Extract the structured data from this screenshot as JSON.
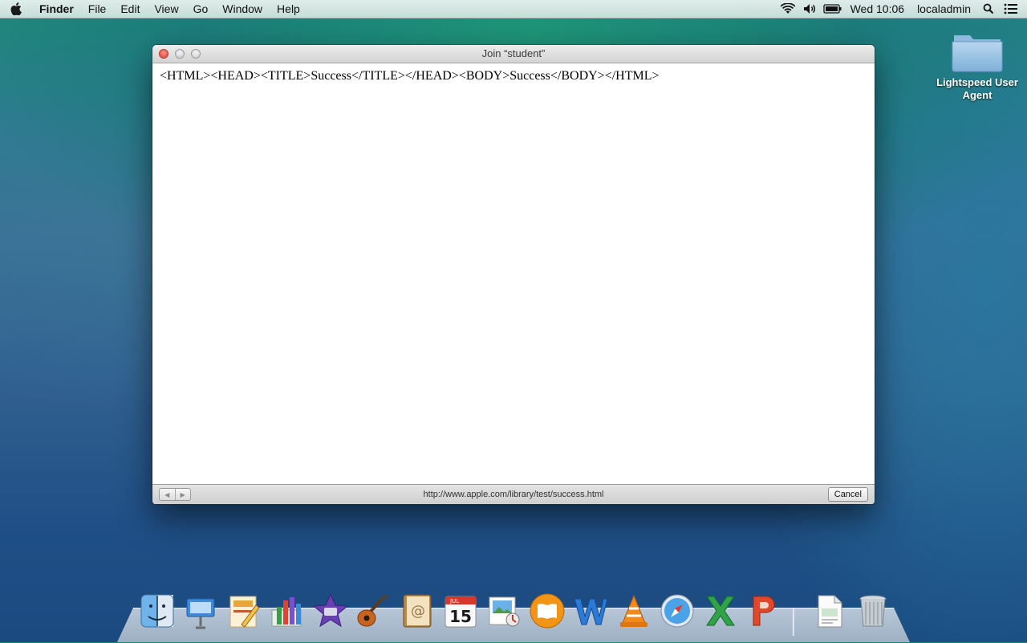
{
  "menubar": {
    "app_name": "Finder",
    "menus": [
      "File",
      "Edit",
      "View",
      "Go",
      "Window",
      "Help"
    ],
    "clock": "Wed 10:06",
    "user": "localadmin"
  },
  "desktop": {
    "folder_label": "Lightspeed User Agent"
  },
  "window": {
    "title": "Join “student”",
    "content_text": "<HTML><HEAD><TITLE>Success</TITLE></HEAD><BODY>Success</BODY></HTML>",
    "url": "http://www.apple.com/library/test/success.html",
    "cancel_label": "Cancel"
  },
  "dock": {
    "items": [
      "finder-icon",
      "keynote-icon",
      "pages-icon",
      "numbers-icon",
      "imovie-icon",
      "garageband-icon",
      "contacts-icon",
      "calendar-icon",
      "preview-icon",
      "ibooks-icon",
      "word-icon",
      "vlc-icon",
      "safari-icon",
      "excel-icon",
      "powerpoint-icon",
      "document-icon",
      "trash-icon"
    ],
    "calendar_day": "15",
    "calendar_month": "JUL"
  },
  "colors": {
    "close_button": "#e0443e",
    "accent": "#1f8a78"
  }
}
